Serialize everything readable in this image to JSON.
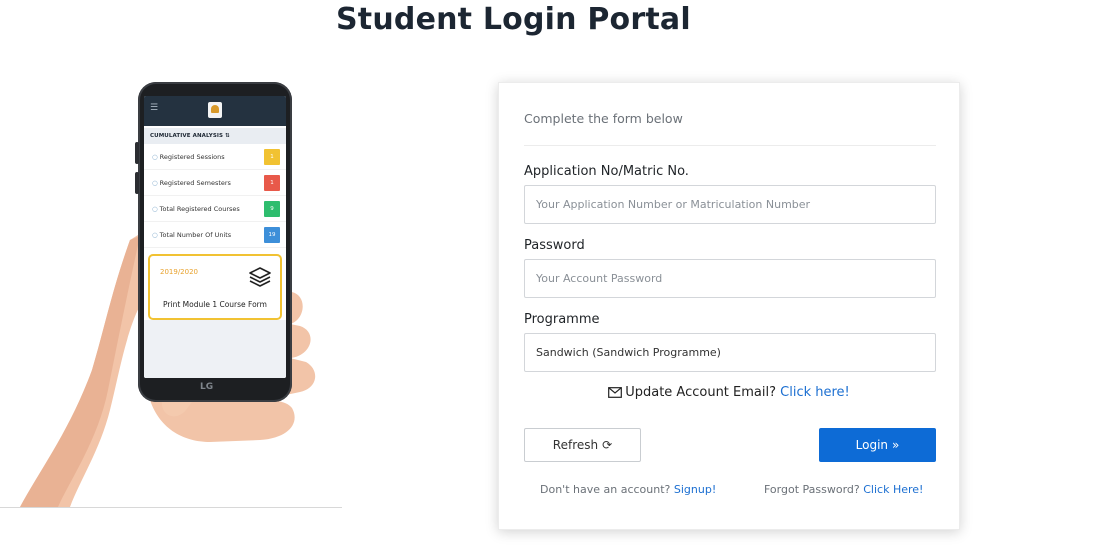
{
  "page": {
    "title": "Student Login Portal"
  },
  "phone": {
    "section_title": "CUMULATIVE ANALYSIS",
    "stats": [
      {
        "label": "Registered Sessions",
        "value": "1",
        "color": "#f1c232"
      },
      {
        "label": "Registered Semesters",
        "value": "1",
        "color": "#e8594a"
      },
      {
        "label": "Total Registered Courses",
        "value": "9",
        "color": "#2ebd6e"
      },
      {
        "label": "Total Number Of Units",
        "value": "19",
        "color": "#3d8fd9"
      }
    ],
    "card_year": "2019/2020",
    "card_label": "Print Module 1 Course Form",
    "brand": "LG"
  },
  "form": {
    "intro": "Complete the form below",
    "application": {
      "label": "Application No/Matric No.",
      "placeholder": "Your Application Number or Matriculation Number"
    },
    "password": {
      "label": "Password",
      "placeholder": "Your Account Password"
    },
    "programme": {
      "label": "Programme",
      "value": "Sandwich (Sandwich Programme)"
    },
    "update_email": {
      "text": "Update Account Email?",
      "link": "Click here!"
    },
    "refresh_label": "Refresh",
    "login_label": "Login",
    "signup": {
      "text": "Don't have an account?",
      "link": "Signup!"
    },
    "forgot": {
      "text": "Forgot Password?",
      "link": "Click Here!"
    }
  },
  "colors": {
    "accent": "#0d6bd6",
    "link": "#1c6fd1",
    "title": "#1c2632"
  }
}
